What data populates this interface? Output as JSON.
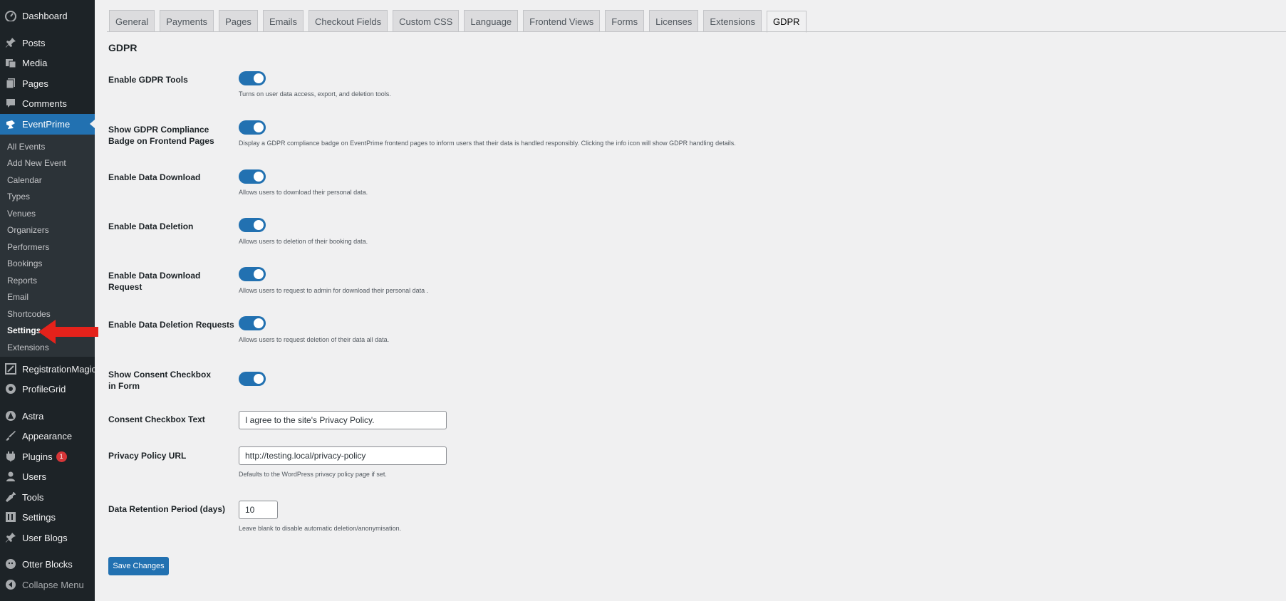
{
  "sidebar": {
    "top_items": [
      {
        "label": "Dashboard",
        "icon": "dashboard-icon"
      },
      {
        "label": "Posts",
        "icon": "pin-icon"
      },
      {
        "label": "Media",
        "icon": "media-icon"
      },
      {
        "label": "Pages",
        "icon": "pages-icon"
      },
      {
        "label": "Comments",
        "icon": "comments-icon"
      },
      {
        "label": "EventPrime",
        "icon": "eventprime-icon"
      }
    ],
    "submenu": [
      "All Events",
      "Add New Event",
      "Calendar",
      "Types",
      "Venues",
      "Organizers",
      "Performers",
      "Bookings",
      "Reports",
      "Email",
      "Shortcodes",
      "Settings",
      "Extensions"
    ],
    "bottom_items": [
      {
        "label": "RegistrationMagic",
        "icon": "registrationmagic-icon"
      },
      {
        "label": "ProfileGrid",
        "icon": "profilegrid-icon"
      },
      {
        "label": "Astra",
        "icon": "astra-icon"
      },
      {
        "label": "Appearance",
        "icon": "appearance-icon"
      },
      {
        "label": "Plugins",
        "icon": "plugins-icon",
        "badge": "1"
      },
      {
        "label": "Users",
        "icon": "users-icon"
      },
      {
        "label": "Tools",
        "icon": "tools-icon"
      },
      {
        "label": "Settings",
        "icon": "settings-icon"
      },
      {
        "label": "User Blogs",
        "icon": "pin-icon"
      },
      {
        "label": "Otter Blocks",
        "icon": "otter-icon"
      },
      {
        "label": "Collapse Menu",
        "icon": "collapse-icon"
      }
    ]
  },
  "tabs": [
    "General",
    "Payments",
    "Pages",
    "Emails",
    "Checkout Fields",
    "Custom CSS",
    "Language",
    "Frontend Views",
    "Forms",
    "Licenses",
    "Extensions",
    "GDPR"
  ],
  "active_tab": "GDPR",
  "section_title": "GDPR",
  "settings": {
    "enable_gdpr_tools": {
      "label": "Enable GDPR Tools",
      "desc": "Turns on user data access, export, and deletion tools.",
      "enabled": true
    },
    "show_badge": {
      "label": "Show GDPR Compliance Badge on Frontend Pages",
      "desc": "Display a GDPR compliance badge on EventPrime frontend pages to inform users that their data is handled responsibly. Clicking the info icon will show GDPR handling details.",
      "enabled": true
    },
    "enable_download": {
      "label": "Enable Data Download",
      "desc": "Allows users to download their personal data.",
      "enabled": true
    },
    "enable_deletion": {
      "label": "Enable Data Deletion",
      "desc": "Allows users to deletion of their booking data.",
      "enabled": true
    },
    "enable_download_request": {
      "label": "Enable Data Download Request",
      "desc": "Allows users to request to admin for download their personal data .",
      "enabled": true
    },
    "enable_deletion_requests": {
      "label": "Enable Data Deletion Requests",
      "desc": "Allows users to request deletion of their data all data.",
      "enabled": true
    },
    "show_consent": {
      "label": "Show Consent Checkbox in Form",
      "enabled": true
    },
    "consent_text": {
      "label": "Consent Checkbox Text",
      "value": "I agree to the site's Privacy Policy."
    },
    "privacy_url": {
      "label": "Privacy Policy URL",
      "value": "http://testing.local/privacy-policy",
      "desc": "Defaults to the WordPress privacy policy page if set."
    },
    "retention": {
      "label": "Data Retention Period (days)",
      "value": "10",
      "desc": "Leave blank to disable automatic deletion/anonymisation."
    }
  },
  "save_label": "Save Changes",
  "colors": {
    "accent": "#2271b1",
    "sidebar": "#1d2327",
    "annotation_arrow": "#e5221b"
  }
}
